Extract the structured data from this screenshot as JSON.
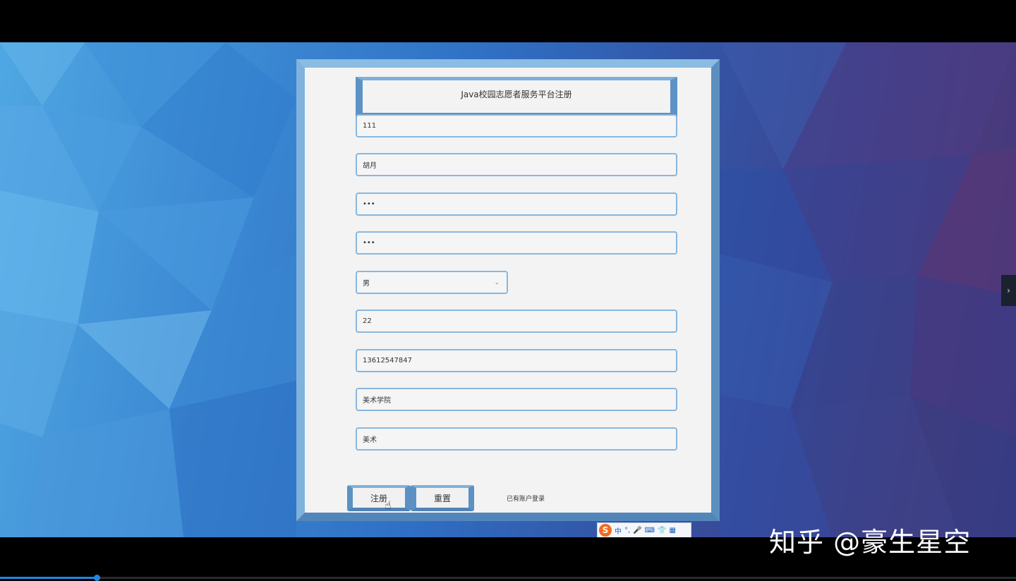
{
  "form": {
    "title": "Java校园志愿者服务平台注册",
    "fields": [
      {
        "name": "username",
        "value": "111"
      },
      {
        "name": "realname",
        "value": "胡月"
      },
      {
        "name": "password",
        "value": "•••"
      },
      {
        "name": "confirm-password",
        "value": "•••"
      },
      {
        "name": "gender",
        "value": "男"
      },
      {
        "name": "age",
        "value": "22"
      },
      {
        "name": "phone",
        "value": "13612547847"
      },
      {
        "name": "college",
        "value": "美术学院"
      },
      {
        "name": "major",
        "value": "美术"
      }
    ],
    "register_label": "注册",
    "reset_label": "重置",
    "login_link": "已有账户登录"
  },
  "ime": {
    "items": [
      "中",
      "°,",
      "🎤",
      "⌨",
      "👕",
      "▦"
    ]
  },
  "watermark": "知乎 @豪生星空",
  "side_tab": "›",
  "player": {
    "progress": 0.095
  },
  "colors": {
    "card_border": "#6ba1cf",
    "field_border": "#88b7de",
    "progress": "#1e88e5"
  }
}
